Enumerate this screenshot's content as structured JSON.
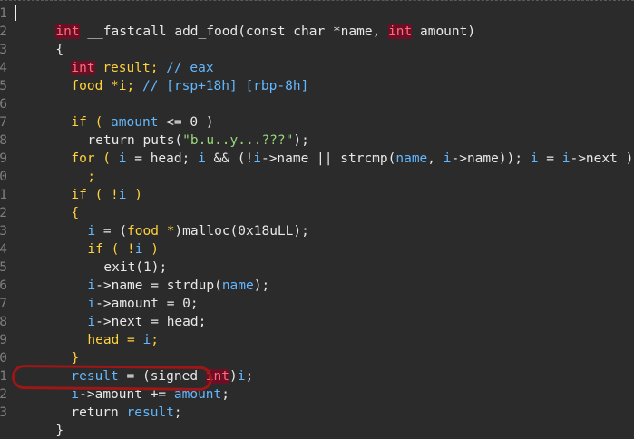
{
  "gutter_digits": [
    "1",
    "2",
    "3",
    "4",
    "5",
    "6",
    "7",
    "8",
    "9",
    "0",
    "1",
    "2",
    "3",
    "4",
    "5",
    "6",
    "7",
    "8",
    "9",
    "0",
    "1",
    "2",
    "3"
  ],
  "code": {
    "l1": {
      "t1": "int",
      "t2": " __fastcall add_food(const char *name, ",
      "t3": "int",
      "t4": " amount)"
    },
    "l2": {
      "t1": "{"
    },
    "l3": {
      "t1": "int",
      "t2": " result; ",
      "t3": "// eax"
    },
    "l4": {
      "t1": "food *i; ",
      "t2": "// [rsp+18h] [rbp-8h]"
    },
    "l5": {},
    "l6": {
      "t1": "if ( ",
      "t2": "amount",
      "t3": " <= 0 )"
    },
    "l7": {
      "t1": "return puts(",
      "t2": "\"b.u..y...???\"",
      "t3": ");"
    },
    "l8": {
      "t1": "for ( ",
      "t2": "i",
      "t3": " = head; ",
      "t4": "i",
      "t5": " && (!",
      "t6": "i",
      "t7": "->name || strcmp(",
      "t8": "name",
      "t9": ", ",
      "t10": "i",
      "t11": "->name)); ",
      "t12": "i",
      "t13": " = ",
      "t14": "i",
      "t15": "->next )"
    },
    "l9": {
      "t1": ";"
    },
    "l10": {
      "t1": "if ( !",
      "t2": "i",
      "t3": " )"
    },
    "l11": {
      "t1": "{"
    },
    "l12": {
      "t1": "i",
      "t2": " = (",
      "t3": "food *",
      "t4": ")malloc(0x18uLL);"
    },
    "l13": {
      "t1": "if ( !",
      "t2": "i",
      "t3": " )"
    },
    "l14": {
      "t1": "exit(1);"
    },
    "l15": {
      "t1": "i",
      "t2": "->name = strdup(",
      "t3": "name",
      "t4": ");"
    },
    "l16": {
      "t1": "i",
      "t2": "->amount = 0;"
    },
    "l17": {
      "t1": "i",
      "t2": "->next = head;"
    },
    "l18": {
      "t1": "head = ",
      "t2": "i",
      "t3": ";"
    },
    "l19": {
      "t1": "}"
    },
    "l20": {
      "t1": "result",
      "t2": " = (signed ",
      "t3": "int",
      "t4": ")",
      "t5": "i",
      "t6": ";"
    },
    "l21": {
      "t1": "i",
      "t2": "->amount += ",
      "t3": "amount",
      "t4": ";"
    },
    "l22": {
      "t1": "return ",
      "t2": "result",
      "t3": ";"
    },
    "l23": {
      "t1": "}"
    }
  },
  "colors": {
    "background": "#2b2b2b",
    "text": "#e8e8e8",
    "keyword": "#ffd23b",
    "variable": "#62b8ff",
    "string": "#99d77a",
    "highlight_bg": "#6b0f24",
    "highlight_fg": "#ff6a7d",
    "annotation": "#9e1616"
  }
}
